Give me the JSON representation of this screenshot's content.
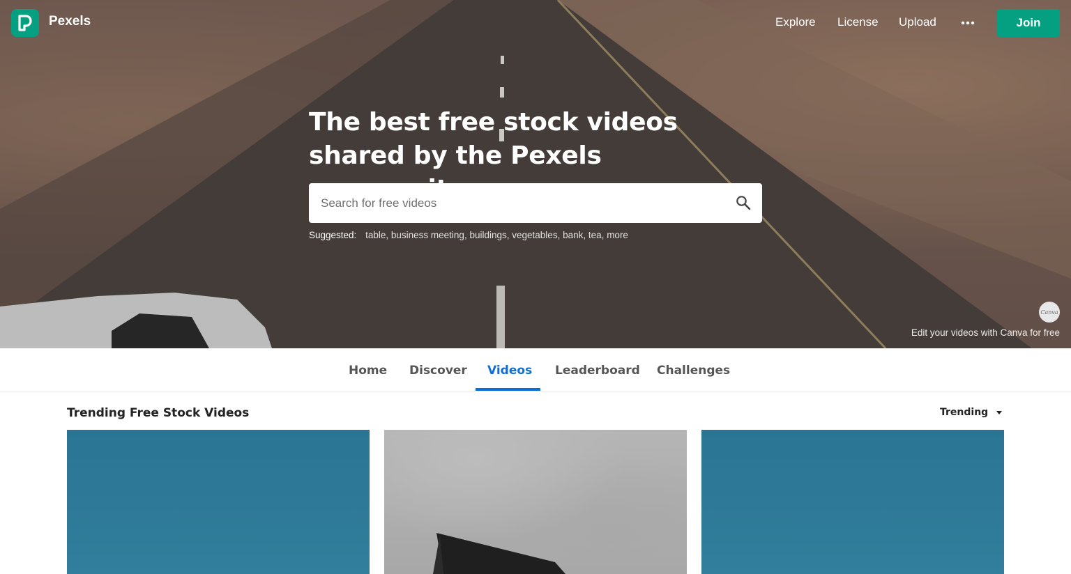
{
  "header": {
    "logo_text": "Pexels",
    "nav": [
      "Explore",
      "License",
      "Upload"
    ],
    "more_icon": "more-dots-icon",
    "join_label": "Join",
    "brand_color": "#05a081"
  },
  "hero": {
    "title": "The best free stock videos shared by the Pexels community.",
    "search_placeholder": "Search for free videos",
    "search_icon": "search-icon",
    "suggested_label": "Suggested:",
    "suggested": [
      "table",
      "business meeting",
      "buildings",
      "vegetables",
      "bank",
      "tea",
      "more"
    ],
    "canva_badge": "Canva",
    "canva_text": "Edit your videos with Canva for free"
  },
  "tabs": {
    "items": [
      "Home",
      "Discover",
      "Videos",
      "Leaderboard",
      "Challenges"
    ],
    "active": "Videos",
    "active_color": "#0e6ed8"
  },
  "main": {
    "section_title": "Trending Free Stock Videos",
    "sort_label": "Trending",
    "thumbnails": [
      "sea",
      "gray",
      "sea"
    ]
  }
}
